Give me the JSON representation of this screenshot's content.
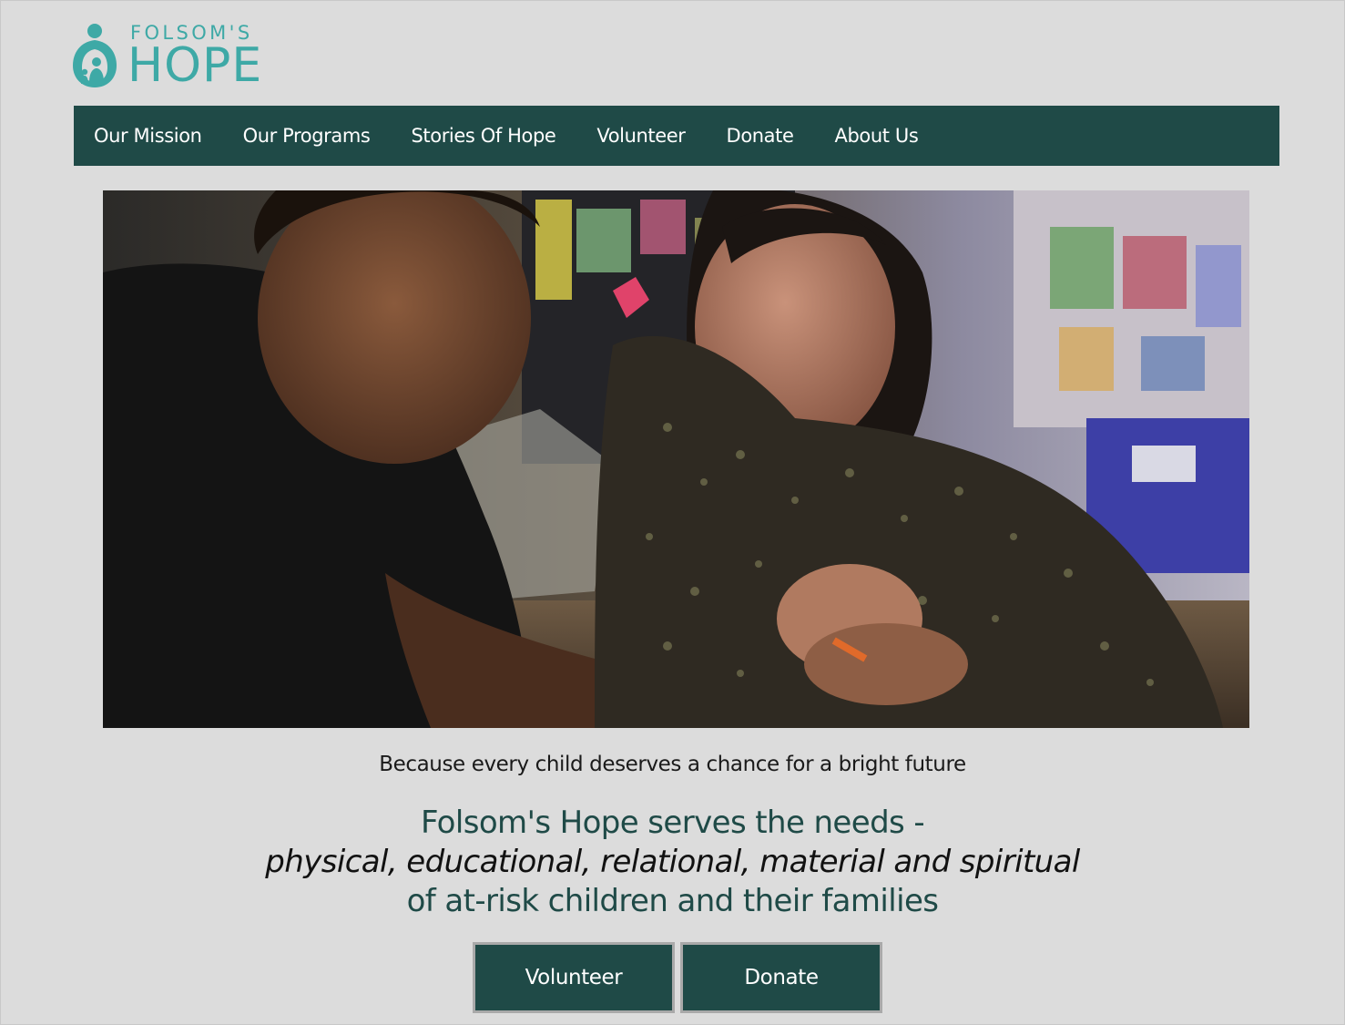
{
  "logo": {
    "top_text": "FOLSOM'S",
    "bottom_text": "HOPE",
    "color": "#3ea9a6"
  },
  "nav": {
    "items": [
      {
        "label": "Our Mission"
      },
      {
        "label": "Our Programs"
      },
      {
        "label": "Stories Of Hope"
      },
      {
        "label": "Volunteer"
      },
      {
        "label": "Donate"
      },
      {
        "label": "About Us"
      }
    ],
    "background": "#1f4a47"
  },
  "hero": {
    "icon": "photo-image"
  },
  "tagline": "Because every child deserves a chance for a bright future",
  "mission": {
    "line1": "Folsom's Hope serves the needs -",
    "line2": "physical, educational, relational, material and spiritual",
    "line3": "of at-risk children and their families"
  },
  "cta": {
    "volunteer_label": "Volunteer",
    "donate_label": "Donate"
  },
  "colors": {
    "page_background": "#dcdcdc",
    "brand_dark": "#1f4a47",
    "brand_teal": "#3ea9a6"
  }
}
